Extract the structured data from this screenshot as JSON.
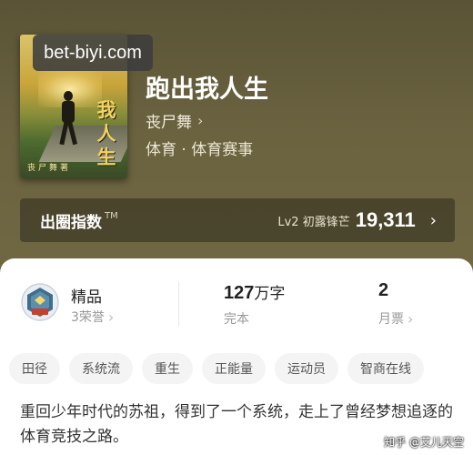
{
  "book": {
    "title": "跑出我人生",
    "author": "丧尸舞",
    "category": "体育 · 体育赛事",
    "cover_title_chars": [
      "我",
      "人",
      "生"
    ],
    "cover_author": "丧尸舞著"
  },
  "watermark": "bet-biyi.com",
  "index": {
    "label": "出圈指数",
    "tm": "TM",
    "level": "Lv2 初露锋芒",
    "value": "19,311"
  },
  "stats": {
    "quality_title": "精品",
    "quality_sub": "3荣誉",
    "words_num": "127",
    "words_unit": "万字",
    "words_sub": "完本",
    "tickets_num": "2",
    "tickets_sub": "月票"
  },
  "tags": [
    "田径",
    "系统流",
    "重生",
    "正能量",
    "运动员",
    "智商在线"
  ],
  "description": "重回少年时代的苏祖，得到了一个系统，走上了曾经梦想追逐的体育竞技之路。",
  "credit": "知乎 @艾儿天空",
  "colors": {
    "header_bg": "#6b6340",
    "panel_bg": "#ffffff",
    "tag_bg": "#f4f4f4"
  }
}
